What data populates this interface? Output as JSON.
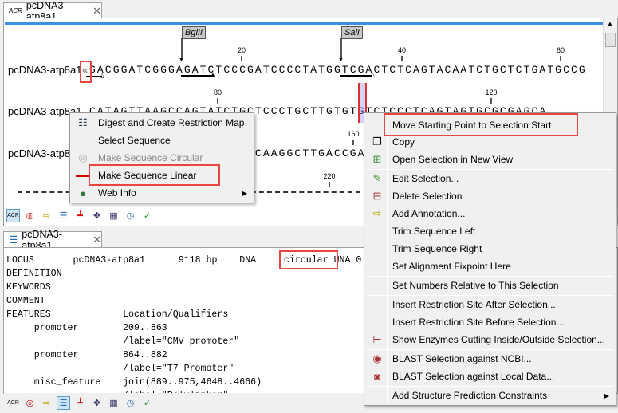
{
  "top_tab": {
    "title": "pcDNA3-atp8a1",
    "icon": "sequence-view-icon"
  },
  "sequence": {
    "name": "pcDNA3-atp8a1",
    "rows": [
      {
        "label": "pcDNA3-atp8a1",
        "start_marker": "«",
        "seq": "GACGGATCGGGAGATCTCCCGATCCCCTATGGTCGACTCTCAGTACAATCTGCTCTGATGCCG"
      },
      {
        "label": "pcDNA3-atp8a1",
        "seq": "CATAGTTAAGCCAGTATCTGCTCCCTGCTTGTGTGTCTCCCTCAGTAGTGCGCGAGCA"
      },
      {
        "label": "pcDNA3-atp8a1",
        "seq": "AAAATTTAAGCTACAACAAGGCAAGGCTTGACCGACAATTGCATGAAGAATCTGCTTAG"
      }
    ],
    "ticks": [
      "20",
      "40",
      "60",
      "80",
      "120",
      "160",
      "220"
    ],
    "enzymes": [
      "BglII",
      "SalI"
    ]
  },
  "toolbar_icons": [
    "sequence-view-icon",
    "circular-view-icon",
    "annotations-icon",
    "text-view-icon",
    "restriction-icon",
    "enzymes-icon",
    "digest-icon",
    "history-icon",
    "check-icon"
  ],
  "left_menu": {
    "items": [
      {
        "label": "Digest and Create Restriction Map",
        "icon": "digest-icon"
      },
      {
        "label": "Select Sequence",
        "icon": ""
      },
      {
        "label": "Make Sequence Circular",
        "icon": "circle-icon",
        "disabled": true
      },
      {
        "label": "Make Sequence Linear",
        "icon": "line-icon"
      },
      {
        "label": "Web Info",
        "icon": "globe-icon",
        "submenu": true
      }
    ]
  },
  "right_menu": {
    "items": [
      {
        "label": "Move Starting Point to Selection Start"
      },
      {
        "label": "Copy",
        "icon": "copy-icon"
      },
      {
        "label": "Open Selection in New View",
        "icon": "new-view-icon"
      },
      {
        "label": "Edit Selection...",
        "icon": "pencil-icon"
      },
      {
        "label": "Delete Selection",
        "icon": "delete-selection-icon"
      },
      {
        "label": "Add Annotation...",
        "icon": "add-annotation-icon"
      },
      {
        "label": "Trim Sequence Left"
      },
      {
        "label": "Trim Sequence Right"
      },
      {
        "label": "Set Alignment Fixpoint Here"
      },
      {
        "label": "Set Numbers Relative to This Selection"
      },
      {
        "label": "Insert Restriction Site After Selection..."
      },
      {
        "label": "Insert Restriction Site Before Selection..."
      },
      {
        "label": "Show Enzymes Cutting Inside/Outside Selection...",
        "icon": "enzymes-cutting-icon"
      },
      {
        "label": "BLAST Selection against NCBI...",
        "icon": "blast-ncbi-icon"
      },
      {
        "label": "BLAST Selection against Local Data...",
        "icon": "blast-local-icon"
      },
      {
        "label": "Add Structure Prediction Constraints",
        "submenu": true
      }
    ]
  },
  "bottom_tab": {
    "title": "pcDNA3-atp8a1",
    "icon": "text-view-icon"
  },
  "genbank": {
    "locus": {
      "key": "LOCUS",
      "name": "pcDNA3-atp8a1",
      "length": "9118 bp",
      "type": "DNA",
      "topology": "circular",
      "rest": "UNA 0"
    },
    "lines": [
      "DEFINITION",
      "KEYWORDS",
      "COMMENT",
      "FEATURES             Location/Qualifiers",
      "     promoter        209..863",
      "                     /label=\"CMV promoter\"",
      "     promoter        864..882",
      "                     /label=\"T7 Promoter\"",
      "     misc_feature    join(889..975,4648..4666)",
      "                     /label=\"Polylinker\""
    ]
  },
  "colors": {
    "highlight": "#e8473f",
    "accent_strip": "#3a8ee6",
    "selection": "#8080ff"
  }
}
